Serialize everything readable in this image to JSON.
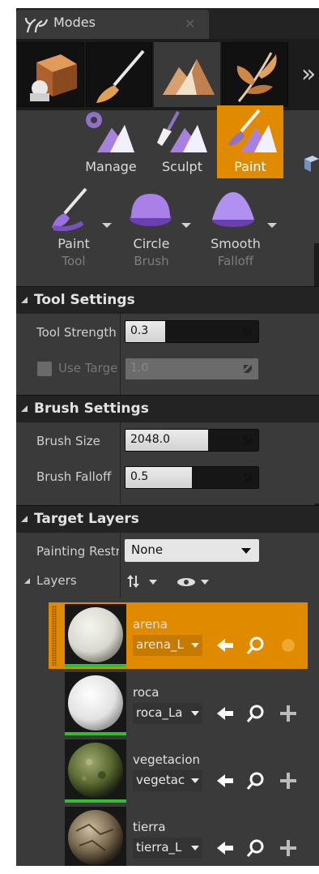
{
  "window": {
    "title": "Modes",
    "close_glyph": "×"
  },
  "modes": {
    "items": [
      {
        "name": "place-mode",
        "icon": "cube-icon"
      },
      {
        "name": "paint-mode",
        "icon": "brush-icon"
      },
      {
        "name": "landscape-mode",
        "icon": "mountain-icon",
        "active": true
      },
      {
        "name": "foliage-mode",
        "icon": "leaf-icon"
      }
    ],
    "more_glyph": "»"
  },
  "tool_tabs": [
    {
      "label": "Manage",
      "icon": "gear-mountain-icon"
    },
    {
      "label": "Sculpt",
      "icon": "trowel-mountain-icon"
    },
    {
      "label": "Paint",
      "icon": "brush-mountain-icon",
      "active": true
    }
  ],
  "tool_options": [
    {
      "line1": "Paint",
      "line2": "Tool",
      "icon": "paint-brush-icon"
    },
    {
      "line1": "Circle",
      "line2": "Brush",
      "icon": "circle-brush-icon"
    },
    {
      "line1": "Smooth",
      "line2": "Falloff",
      "icon": "smooth-falloff-icon"
    }
  ],
  "tool_settings": {
    "title": "Tool Settings",
    "strength": {
      "label": "Tool Strength",
      "value": "0.3",
      "fraction": 0.3
    },
    "use_target": {
      "label": "Use Target Value",
      "value": "1.0",
      "fraction": 1.0,
      "checked": false
    }
  },
  "brush_settings": {
    "title": "Brush Settings",
    "size": {
      "label": "Brush Size",
      "value": "2048.0",
      "fraction": 0.62
    },
    "falloff": {
      "label": "Brush Falloff",
      "value": "0.5",
      "fraction": 0.5
    }
  },
  "target_layers": {
    "title": "Target Layers",
    "painting_restriction": {
      "label": "Painting Restriction",
      "value": "None"
    },
    "layers_label": "Layers",
    "layers": [
      {
        "name": "arena",
        "info": "arena_L",
        "active": true,
        "material": "white"
      },
      {
        "name": "roca",
        "info": "roca_La",
        "active": false,
        "material": "white"
      },
      {
        "name": "vegetacion",
        "info": "vegetac",
        "active": false,
        "material": "grass"
      },
      {
        "name": "tierra",
        "info": "tierra_L",
        "active": false,
        "material": "rock"
      }
    ]
  },
  "colors": {
    "accent": "#e08a00",
    "panel": "#3a3a3a",
    "header": "#232323",
    "layer_weight": "#2fbf2f"
  }
}
